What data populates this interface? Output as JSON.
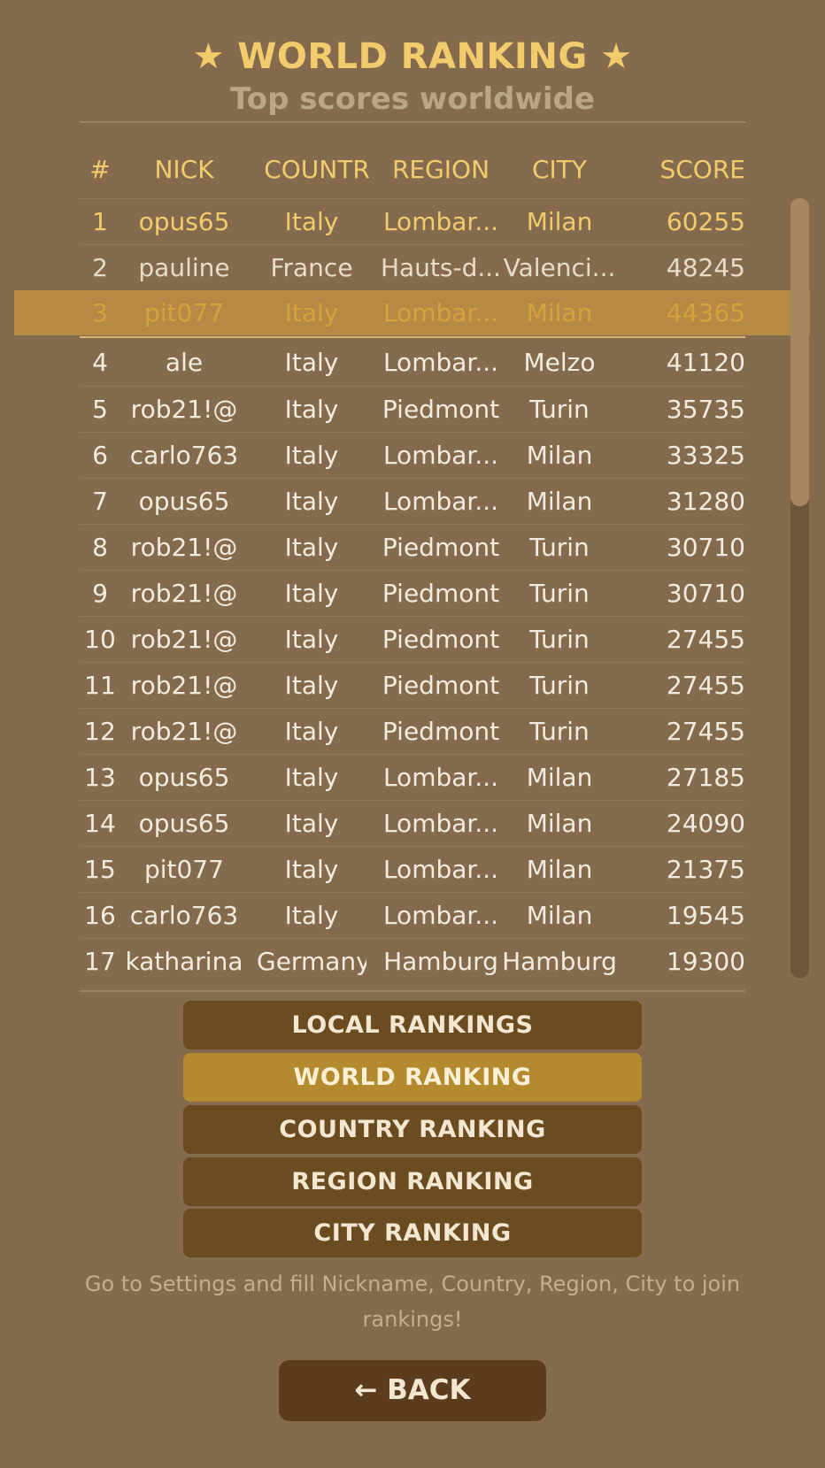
{
  "header": {
    "title": "★ WORLD RANKING ★",
    "subtitle": "Top scores worldwide"
  },
  "table": {
    "columns": [
      "#",
      "NICK",
      "COUNTR",
      "REGION",
      "CITY",
      "SCORE"
    ],
    "highlight_color": "#b68a45",
    "rows": [
      {
        "rank": "1",
        "nick": "opus65",
        "country": "Italy",
        "region": "Lombar...",
        "city": "Milan",
        "score": "60255"
      },
      {
        "rank": "2",
        "nick": "pauline",
        "country": "France",
        "region": "Hauts-d...",
        "city": "Valenci...",
        "score": "48245"
      },
      {
        "rank": "3",
        "nick": "pit077",
        "country": "Italy",
        "region": "Lombar...",
        "city": "Milan",
        "score": "44365"
      },
      {
        "rank": "4",
        "nick": "ale",
        "country": "Italy",
        "region": "Lombar...",
        "city": "Melzo",
        "score": "41120"
      },
      {
        "rank": "5",
        "nick": "rob21!@",
        "country": "Italy",
        "region": "Piedmont",
        "city": "Turin",
        "score": "35735"
      },
      {
        "rank": "6",
        "nick": "carlo763",
        "country": "Italy",
        "region": "Lombar...",
        "city": "Milan",
        "score": "33325"
      },
      {
        "rank": "7",
        "nick": "opus65",
        "country": "Italy",
        "region": "Lombar...",
        "city": "Milan",
        "score": "31280"
      },
      {
        "rank": "8",
        "nick": "rob21!@",
        "country": "Italy",
        "region": "Piedmont",
        "city": "Turin",
        "score": "30710"
      },
      {
        "rank": "9",
        "nick": "rob21!@",
        "country": "Italy",
        "region": "Piedmont",
        "city": "Turin",
        "score": "30710"
      },
      {
        "rank": "10",
        "nick": "rob21!@",
        "country": "Italy",
        "region": "Piedmont",
        "city": "Turin",
        "score": "27455"
      },
      {
        "rank": "11",
        "nick": "rob21!@",
        "country": "Italy",
        "region": "Piedmont",
        "city": "Turin",
        "score": "27455"
      },
      {
        "rank": "12",
        "nick": "rob21!@",
        "country": "Italy",
        "region": "Piedmont",
        "city": "Turin",
        "score": "27455"
      },
      {
        "rank": "13",
        "nick": "opus65",
        "country": "Italy",
        "region": "Lombar...",
        "city": "Milan",
        "score": "27185"
      },
      {
        "rank": "14",
        "nick": "opus65",
        "country": "Italy",
        "region": "Lombar...",
        "city": "Milan",
        "score": "24090"
      },
      {
        "rank": "15",
        "nick": "pit077",
        "country": "Italy",
        "region": "Lombar...",
        "city": "Milan",
        "score": "21375"
      },
      {
        "rank": "16",
        "nick": "carlo763",
        "country": "Italy",
        "region": "Lombar...",
        "city": "Milan",
        "score": "19545"
      },
      {
        "rank": "17",
        "nick": "katharina",
        "country": "Germany",
        "region": "Hamburg",
        "city": "Hamburg",
        "score": "19300"
      }
    ]
  },
  "buttons": {
    "local": "LOCAL RANKINGS",
    "world": "WORLD RANKING",
    "country": "COUNTRY RANKING",
    "region": "REGION RANKING",
    "city": "CITY RANKING",
    "active": "world"
  },
  "notice": "Go to Settings and fill Nickname, Country, Region, City to join rankings!",
  "back_label": "← BACK",
  "colors": {
    "background": "#856b4e",
    "accent": "#f2cc6c",
    "button": "#6b4b20",
    "button_active": "#b38b2e"
  }
}
